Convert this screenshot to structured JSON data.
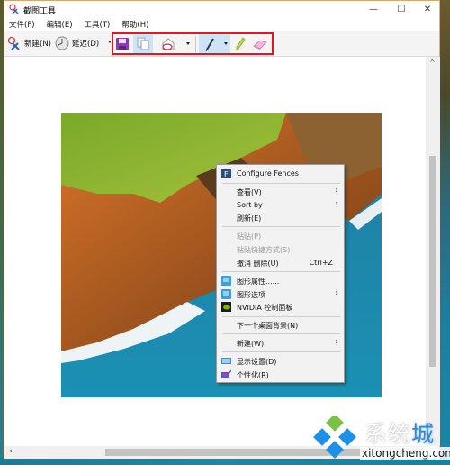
{
  "window": {
    "title": "截图工具",
    "controls": {
      "minimize": "—",
      "maximize": "☐",
      "close": "✕"
    }
  },
  "menubar": {
    "items": [
      {
        "label": "文件(F)"
      },
      {
        "label": "编辑(E)"
      },
      {
        "label": "工具(T)"
      },
      {
        "label": "帮助(H)"
      }
    ]
  },
  "toolbar": {
    "new_label": "新建(N)",
    "delay_label": "延迟(D)",
    "icons": [
      "save-icon",
      "copy-icon",
      "send-email-icon",
      "pen-icon",
      "highlighter-icon",
      "eraser-icon"
    ],
    "highlight_color": "#e8141e"
  },
  "context_menu": {
    "items": [
      {
        "label": "Configure Fences",
        "icon": "fences-icon",
        "type": "item"
      },
      {
        "type": "separator"
      },
      {
        "label": "查看(V)",
        "submenu": true,
        "type": "item"
      },
      {
        "label": "Sort by",
        "submenu": true,
        "type": "item"
      },
      {
        "label": "刷新(E)",
        "type": "item"
      },
      {
        "type": "separator"
      },
      {
        "label": "粘贴(P)",
        "disabled": true,
        "type": "item"
      },
      {
        "label": "粘贴快捷方式(S)",
        "disabled": true,
        "type": "item"
      },
      {
        "label": "撤消 删除(U)",
        "shortcut": "Ctrl+Z",
        "type": "item"
      },
      {
        "type": "separator"
      },
      {
        "label": "图形属性......",
        "icon": "intel-graphics-icon",
        "type": "item"
      },
      {
        "label": "图形选项",
        "icon": "intel-graphics-icon",
        "submenu": true,
        "type": "item"
      },
      {
        "label": "NVIDIA 控制面板",
        "icon": "nvidia-icon",
        "type": "item"
      },
      {
        "type": "separator"
      },
      {
        "label": "下一个桌面背景(N)",
        "type": "item"
      },
      {
        "type": "separator"
      },
      {
        "label": "新建(W)",
        "submenu": true,
        "type": "item"
      },
      {
        "type": "separator"
      },
      {
        "label": "显示设置(D)",
        "icon": "display-icon",
        "type": "item"
      },
      {
        "label": "个性化(R)",
        "icon": "personalize-icon",
        "type": "item"
      }
    ]
  },
  "watermark": {
    "text_main": "系统",
    "text_accent": "城",
    "url": "xitongcheng.com"
  }
}
